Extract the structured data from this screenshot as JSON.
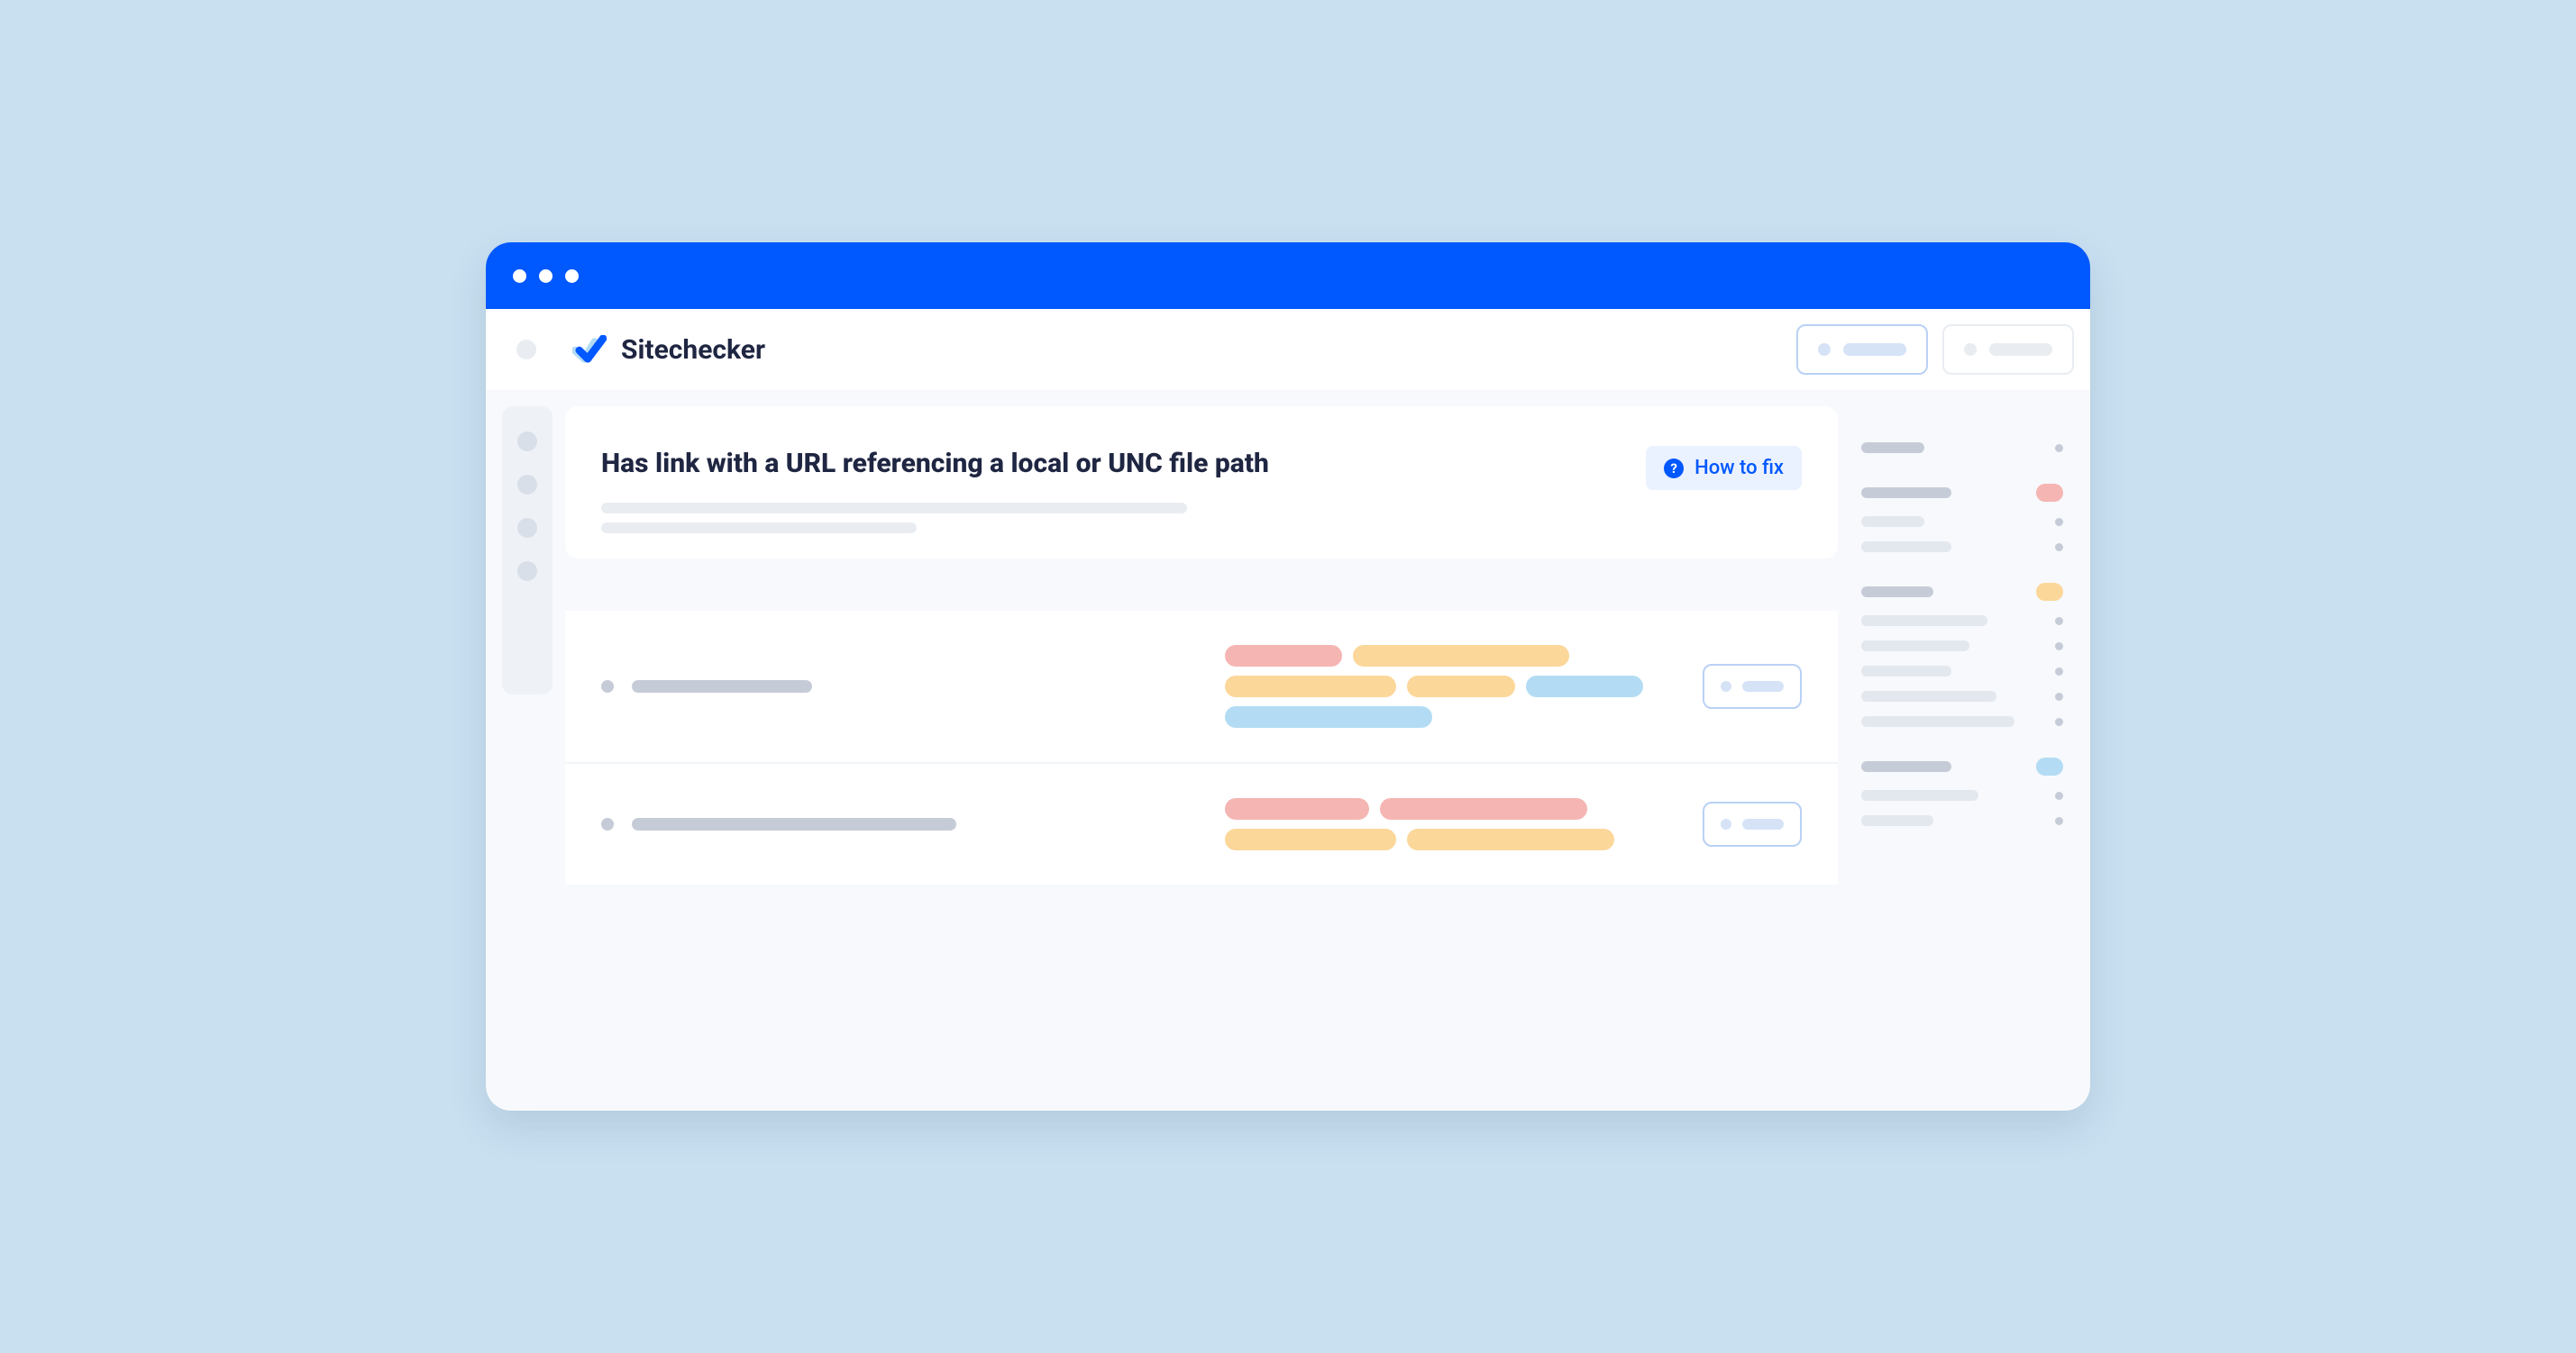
{
  "brand": "Sitechecker",
  "issue_title": "Has link with a URL referencing a local or UNC file path",
  "howtofix_label": "How to fix"
}
